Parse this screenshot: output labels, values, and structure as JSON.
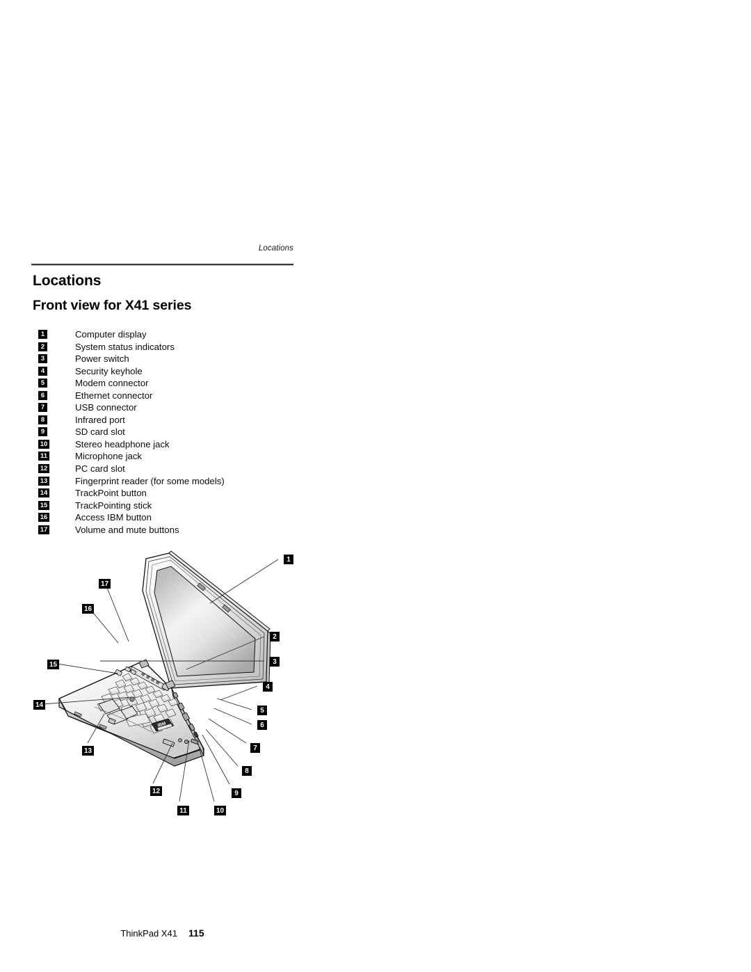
{
  "page": {
    "running_head": "Locations",
    "title": "Locations",
    "subtitle": "Front view for X41 series"
  },
  "legend": {
    "items": [
      {
        "num": "1",
        "label": "Computer display"
      },
      {
        "num": "2",
        "label": "System status indicators"
      },
      {
        "num": "3",
        "label": "Power switch"
      },
      {
        "num": "4",
        "label": "Security keyhole"
      },
      {
        "num": "5",
        "label": "Modem connector"
      },
      {
        "num": "6",
        "label": "Ethernet connector"
      },
      {
        "num": "7",
        "label": "USB connector"
      },
      {
        "num": "8",
        "label": "Infrared port"
      },
      {
        "num": "9",
        "label": "SD card slot"
      },
      {
        "num": "10",
        "label": "Stereo headphone jack"
      },
      {
        "num": "11",
        "label": "Microphone jack"
      },
      {
        "num": "12",
        "label": "PC card slot"
      },
      {
        "num": "13",
        "label": "Fingerprint reader (for some models)"
      },
      {
        "num": "14",
        "label": "TrackPoint button"
      },
      {
        "num": "15",
        "label": "TrackPointing stick"
      },
      {
        "num": "16",
        "label": "Access IBM button"
      },
      {
        "num": "17",
        "label": "Volume and mute buttons"
      }
    ]
  },
  "figure": {
    "alt": "Front view line drawing of ThinkPad X41 notebook computer with numbered callouts",
    "logo_text": "IBM",
    "callouts": [
      {
        "num": "1",
        "bx": 368,
        "by": 7,
        "lx1": 360,
        "ly1": 14,
        "lx2": 262,
        "ly2": 77
      },
      {
        "num": "2",
        "bx": 348,
        "by": 118,
        "lx1": 340,
        "ly1": 125,
        "lx2": 228,
        "ly2": 172
      },
      {
        "num": "3",
        "bx": 348,
        "by": 154,
        "lx1": 340,
        "ly1": 160,
        "lx2": 104,
        "ly2": 160
      },
      {
        "num": "4",
        "bx": 338,
        "by": 190,
        "lx1": 330,
        "ly1": 196,
        "lx2": 277,
        "ly2": 216
      },
      {
        "num": "5",
        "bx": 330,
        "by": 224,
        "lx1": 322,
        "ly1": 230,
        "lx2": 272,
        "ly2": 214
      },
      {
        "num": "6",
        "bx": 330,
        "by": 245,
        "lx1": 322,
        "ly1": 251,
        "lx2": 268,
        "ly2": 228
      },
      {
        "num": "7",
        "bx": 320,
        "by": 278,
        "lx1": 314,
        "ly1": 278,
        "lx2": 260,
        "ly2": 243
      },
      {
        "num": "8",
        "bx": 308,
        "by": 311,
        "lx1": 302,
        "ly1": 311,
        "lx2": 256,
        "ly2": 258
      },
      {
        "num": "9",
        "bx": 293,
        "by": 343,
        "lx1": 290,
        "ly1": 337,
        "lx2": 251,
        "ly2": 266
      },
      {
        "num": "10",
        "bx": 268,
        "by": 368,
        "lx1": 268,
        "ly1": 362,
        "lx2": 243,
        "ly2": 272
      },
      {
        "num": "11",
        "bx": 215,
        "by": 368,
        "lx1": 218,
        "ly1": 362,
        "lx2": 232,
        "ly2": 274
      },
      {
        "num": "12",
        "bx": 176,
        "by": 340,
        "lx1": 180,
        "ly1": 336,
        "lx2": 208,
        "ly2": 278
      },
      {
        "num": "13",
        "bx": 78,
        "by": 282,
        "lx1": 86,
        "ly1": 278,
        "lx2": 110,
        "ly2": 236
      },
      {
        "num": "14",
        "bx": 8,
        "by": 216,
        "lx1": 22,
        "ly1": 222,
        "lx2": 150,
        "ly2": 212
      },
      {
        "num": "15",
        "bx": 28,
        "by": 158,
        "lx1": 42,
        "ly1": 164,
        "lx2": 130,
        "ly2": 178
      },
      {
        "num": "16",
        "bx": 78,
        "by": 78,
        "lx1": 90,
        "ly1": 86,
        "lx2": 130,
        "ly2": 134
      },
      {
        "num": "17",
        "bx": 102,
        "by": 42,
        "lx1": 112,
        "ly1": 50,
        "lx2": 145,
        "ly2": 132
      }
    ]
  },
  "footer": {
    "document_name": "ThinkPad X41",
    "page_number": "115"
  },
  "colors": {
    "ink": "#000000",
    "paper": "#ffffff",
    "rule": "#3a3a3a",
    "screen_light": "#f2f2f2",
    "screen_mid": "#c9c9c9",
    "screen_dark": "#9a9a9a"
  }
}
